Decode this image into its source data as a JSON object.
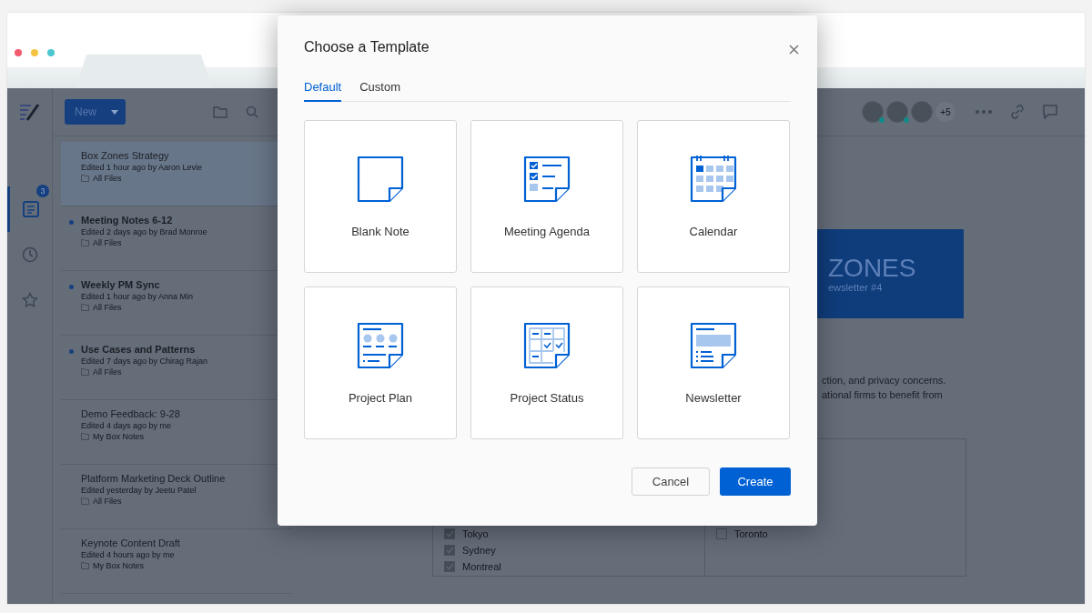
{
  "browser": {
    "window_controls": [
      {
        "color": "#f25a6e"
      },
      {
        "color": "#f5c344"
      },
      {
        "color": "#4ec6cf"
      }
    ]
  },
  "app": {
    "rail": [
      {
        "kind": "notes",
        "selected": true,
        "badge": "3"
      },
      {
        "kind": "recent",
        "selected": false
      },
      {
        "kind": "starred",
        "selected": false
      }
    ],
    "toolbar": {
      "new_button": "New",
      "collaborators": [
        {
          "online": true
        },
        {
          "online": true
        },
        {
          "online": false
        }
      ],
      "more_collaborators": "+5"
    },
    "notes": [
      {
        "title": "Box Zones Strategy",
        "edited": "Edited 1 hour ago by Aaron Levie",
        "folder": "All Files",
        "unread": false,
        "selected": true
      },
      {
        "title": "Meeting Notes 6-12",
        "edited": "Edited 2 days ago by Brad Monroe",
        "folder": "All Files",
        "unread": true,
        "selected": false
      },
      {
        "title": "Weekly PM Sync",
        "edited": "Edited 1 hour ago by Anna Min",
        "folder": "All Files",
        "unread": true,
        "selected": false
      },
      {
        "title": "Use Cases and Patterns",
        "edited": "Edited 7 days ago by Chirag Rajan",
        "folder": "All Files",
        "unread": true,
        "selected": false
      },
      {
        "title": "Demo Feedback: 9-28",
        "edited": "Edited 4 days ago by me",
        "folder": "My Box Notes",
        "unread": false,
        "selected": false
      },
      {
        "title": "Platform Marketing Deck Outline",
        "edited": "Edited yesterday by Jeetu Patel",
        "folder": "All Files",
        "unread": false,
        "selected": false
      },
      {
        "title": "Keynote Content Draft",
        "edited": "Edited 4 hours ago by me",
        "folder": "My Box Notes",
        "unread": false,
        "selected": false
      }
    ],
    "document": {
      "banner_title": "ZONES",
      "banner_subtitle": "ewsletter #4",
      "paragraph_lines": [
        "ction, and privacy concerns.",
        "ational firms to benefit from"
      ],
      "checklist_left": [
        {
          "label": "Tokyo",
          "checked": true
        },
        {
          "label": "Sydney",
          "checked": true
        },
        {
          "label": "Montreal",
          "checked": true
        }
      ],
      "checklist_right": [
        {
          "label": "Toronto",
          "checked": false
        }
      ]
    }
  },
  "dialog": {
    "title": "Choose a Template",
    "tabs": [
      {
        "label": "Default",
        "selected": true
      },
      {
        "label": "Custom",
        "selected": false
      }
    ],
    "templates": [
      {
        "label": "Blank Note",
        "kind": "blank"
      },
      {
        "label": "Meeting Agenda",
        "kind": "agenda"
      },
      {
        "label": "Calendar",
        "kind": "calendar"
      },
      {
        "label": "Project Plan",
        "kind": "plan"
      },
      {
        "label": "Project Status",
        "kind": "status"
      },
      {
        "label": "Newsletter",
        "kind": "newsletter"
      }
    ],
    "buttons": [
      {
        "label": "Cancel",
        "kind": "secondary"
      },
      {
        "label": "Create",
        "kind": "primary"
      }
    ]
  }
}
